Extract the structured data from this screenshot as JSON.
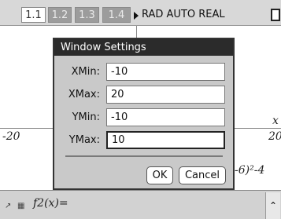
{
  "tabs": [
    {
      "label": "1.1",
      "active": true
    },
    {
      "label": "1.2",
      "active": false
    },
    {
      "label": "1.3",
      "active": false
    },
    {
      "label": "1.4",
      "active": false
    }
  ],
  "status": {
    "mode": "RAD AUTO REAL"
  },
  "graph": {
    "left_label": "-20",
    "right_label": "20",
    "x_label": "x",
    "func_fragment": "-6)²-4"
  },
  "dialog": {
    "title": "Window Settings",
    "fields": [
      {
        "label": "XMin:",
        "value": "-10"
      },
      {
        "label": "XMax:",
        "value": "20"
      },
      {
        "label": "YMin:",
        "value": "-10"
      },
      {
        "label": "YMax:",
        "value": "10"
      }
    ],
    "ok_label": "OK",
    "cancel_label": "Cancel"
  },
  "entry": {
    "text": "f2(x)="
  },
  "colors": {
    "title_bar": "#2b2b2b",
    "dialog_bg": "#c9c9c9",
    "inactive_tab": "#9c9c9c"
  }
}
